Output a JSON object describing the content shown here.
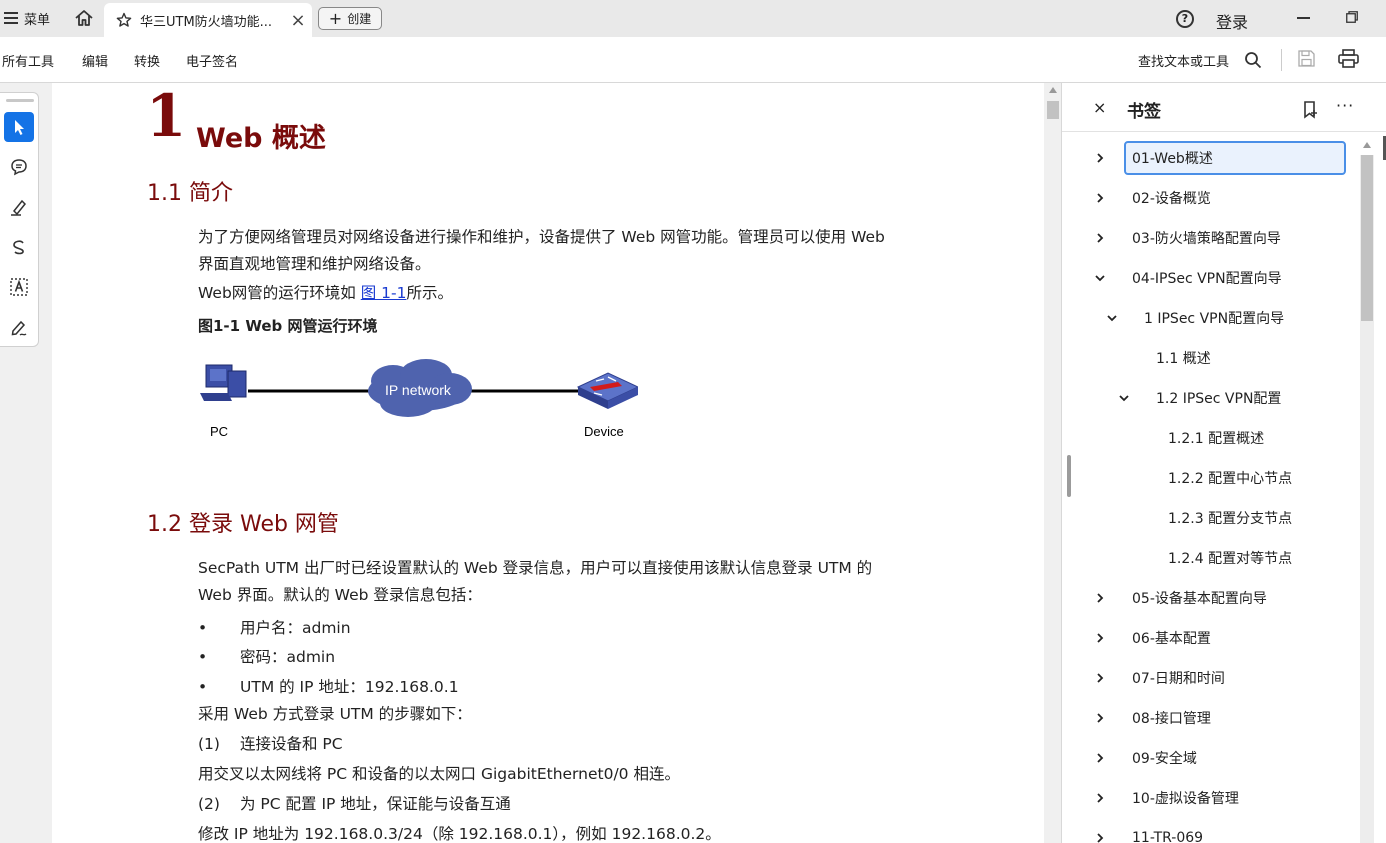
{
  "titlebar": {
    "menu_label": "菜单",
    "tab_title": "华三UTM防火墙功能...",
    "tab_close": "×",
    "create_label": "创建",
    "help": "?",
    "login_label": "登录"
  },
  "toolbar": {
    "items": [
      "所有工具",
      "编辑",
      "转换",
      "电子签名"
    ],
    "find_label": "查找文本或工具"
  },
  "document": {
    "chapter_number": "1",
    "chapter_title": "Web 概述",
    "section1_title": "1.1  简介",
    "section1_para1_line1": "为了方便网络管理员对网络设备进行操作和维护，设备提供了 Web 网管功能。管理员可以使用 Web",
    "section1_para1_line2": "界面直观地管理和维护网络设备。",
    "section1_para2_prefix": "Web网管的运行环境如 ",
    "section1_para2_link": "图 1-1",
    "section1_para2_suffix": "所示。",
    "figure_caption": "图1-1  Web 网管运行环境",
    "figure_labels": {
      "pc": "PC",
      "cloud": "IP network",
      "device": "Device"
    },
    "section2_title": "1.2  登录 Web 网管",
    "section2_para1_line1": "SecPath UTM 出厂时已经设置默认的 Web 登录信息，用户可以直接使用该默认信息登录 UTM 的",
    "section2_para1_line2": "Web 界面。默认的 Web 登录信息包括：",
    "bullets": [
      "用户名：admin",
      "密码：admin",
      "UTM 的 IP 地址：192.168.0.1"
    ],
    "bullet_symbol": "•",
    "steps_intro": "采用 Web 方式登录 UTM 的步骤如下：",
    "step1_num": "(1)",
    "step1_text": "连接设备和 PC",
    "step1_desc": "用交叉以太网线将 PC 和设备的以太网口 GigabitEthernet0/0 相连。",
    "step2_num": "(2)",
    "step2_text": "为 PC 配置 IP 地址，保证能与设备互通",
    "step2_desc": "修改 IP 地址为 192.168.0.3/24（除 192.168.0.1），例如 192.168.0.2。"
  },
  "bookmarks": {
    "title": "书签",
    "close": "×",
    "more": "···",
    "items": [
      {
        "label": "01-Web概述",
        "expanded": false,
        "selected": true
      },
      {
        "label": "02-设备概览",
        "expanded": false
      },
      {
        "label": "03-防火墙策略配置向导",
        "expanded": false
      },
      {
        "label": "04-IPSec VPN配置向导",
        "expanded": true
      },
      {
        "label": "1  IPSec VPN配置向导",
        "expanded": true
      },
      {
        "label": "1.1   概述"
      },
      {
        "label": "1.2   IPSec VPN配置",
        "expanded": true
      },
      {
        "label": "1.2.1    配置概述"
      },
      {
        "label": "1.2.2    配置中心节点"
      },
      {
        "label": "1.2.3    配置分支节点"
      },
      {
        "label": "1.2.4    配置对等节点"
      },
      {
        "label": "05-设备基本配置向导",
        "expanded": false
      },
      {
        "label": "06-基本配置",
        "expanded": false
      },
      {
        "label": "07-日期和时间",
        "expanded": false
      },
      {
        "label": "08-接口管理",
        "expanded": false
      },
      {
        "label": "09-安全域",
        "expanded": false
      },
      {
        "label": "10-虚拟设备管理",
        "expanded": false
      },
      {
        "label": "11-TR-069",
        "expanded": false
      }
    ]
  },
  "colors": {
    "heading": "#7a0b0b",
    "link": "#1a3bd1",
    "accent": "#1473e6",
    "selection_border": "#4a8fe7"
  }
}
